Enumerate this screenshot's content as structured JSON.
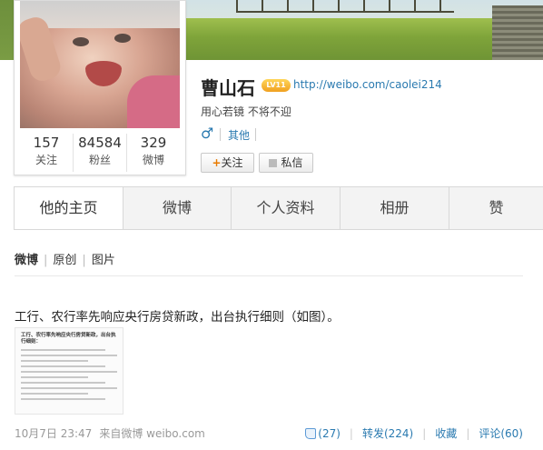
{
  "profile": {
    "name": "曹山石",
    "level": "LV11",
    "url": "http://weibo.com/caolei214",
    "motto": "用心若镜 不将不迎",
    "gender_symbol": "♂",
    "tag": "其他",
    "stats": [
      {
        "num": "157",
        "label": "关注"
      },
      {
        "num": "84584",
        "label": "粉丝"
      },
      {
        "num": "329",
        "label": "微博"
      }
    ],
    "follow_label": "关注",
    "follow_plus": "+",
    "message_label": "私信"
  },
  "tabs": [
    {
      "label": "他的主页",
      "active": true
    },
    {
      "label": "微博"
    },
    {
      "label": "个人资料"
    },
    {
      "label": "相册"
    },
    {
      "label": "赞"
    }
  ],
  "feed": {
    "subtabs": [
      "微博",
      "原创",
      "图片"
    ],
    "post_text": "工行、农行率先响应央行房贷新政，出台执行细则（如图）。",
    "thumb_title": "工行、农行率先响应央行房贷新政，出台执行细则：",
    "timestamp": "10月7日 23:47",
    "source": "来自微博 weibo.com",
    "likes": "(27)",
    "repost": "转发(224)",
    "favorite": "收藏",
    "comment": "评论(60)"
  },
  "colors": {
    "link": "#2a7ab0",
    "accent": "#e87a00"
  }
}
